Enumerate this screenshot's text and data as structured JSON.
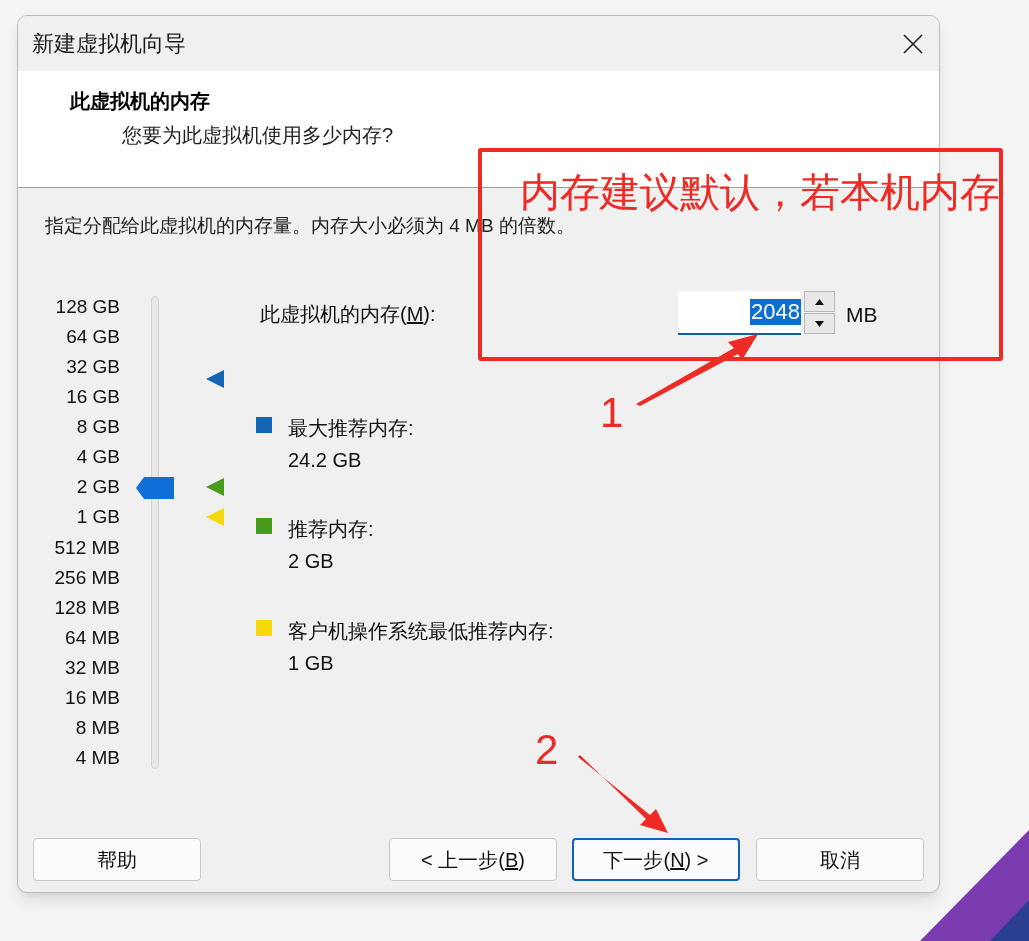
{
  "window": {
    "title": "新建虚拟机向导"
  },
  "header": {
    "title": "此虚拟机的内存",
    "subtitle": "您要为此虚拟机使用多少内存?"
  },
  "description": "指定分配给此虚拟机的内存量。内存大小必须为 4 MB 的倍数。",
  "slider": {
    "ticks": [
      "128 GB",
      "64 GB",
      "32 GB",
      "16 GB",
      "8 GB",
      "4 GB",
      "2 GB",
      "1 GB",
      "512 MB",
      "256 MB",
      "128 MB",
      "64 MB",
      "32 MB",
      "16 MB",
      "8 MB",
      "4 MB"
    ],
    "level": 0.6
  },
  "memory_field": {
    "label_before": "此虚拟机的内存(",
    "mnemonic": "M",
    "label_after": "):",
    "value": "2048",
    "unit": "MB"
  },
  "legend": [
    {
      "label": "最大推荐内存:",
      "value": "24.2 GB",
      "color": "#1565b5"
    },
    {
      "label": "推荐内存:",
      "value": "2 GB",
      "color": "#4a9a1c"
    },
    {
      "label": "客户机操作系统最低推荐内存:",
      "value": "1 GB",
      "color": "#f5d90a"
    }
  ],
  "buttons": [
    {
      "before": "帮助",
      "focused": false
    },
    {
      "before": "< 上一步(",
      "mnemonic": "B",
      "after": ")",
      "focused": false
    },
    {
      "before": "下一步(",
      "mnemonic": "N",
      "after": ") >",
      "focused": true
    },
    {
      "before": "取消",
      "focused": false
    }
  ],
  "annotations": {
    "note": "内存建议默认，若本机内存",
    "markers": [
      "1",
      "2"
    ]
  }
}
